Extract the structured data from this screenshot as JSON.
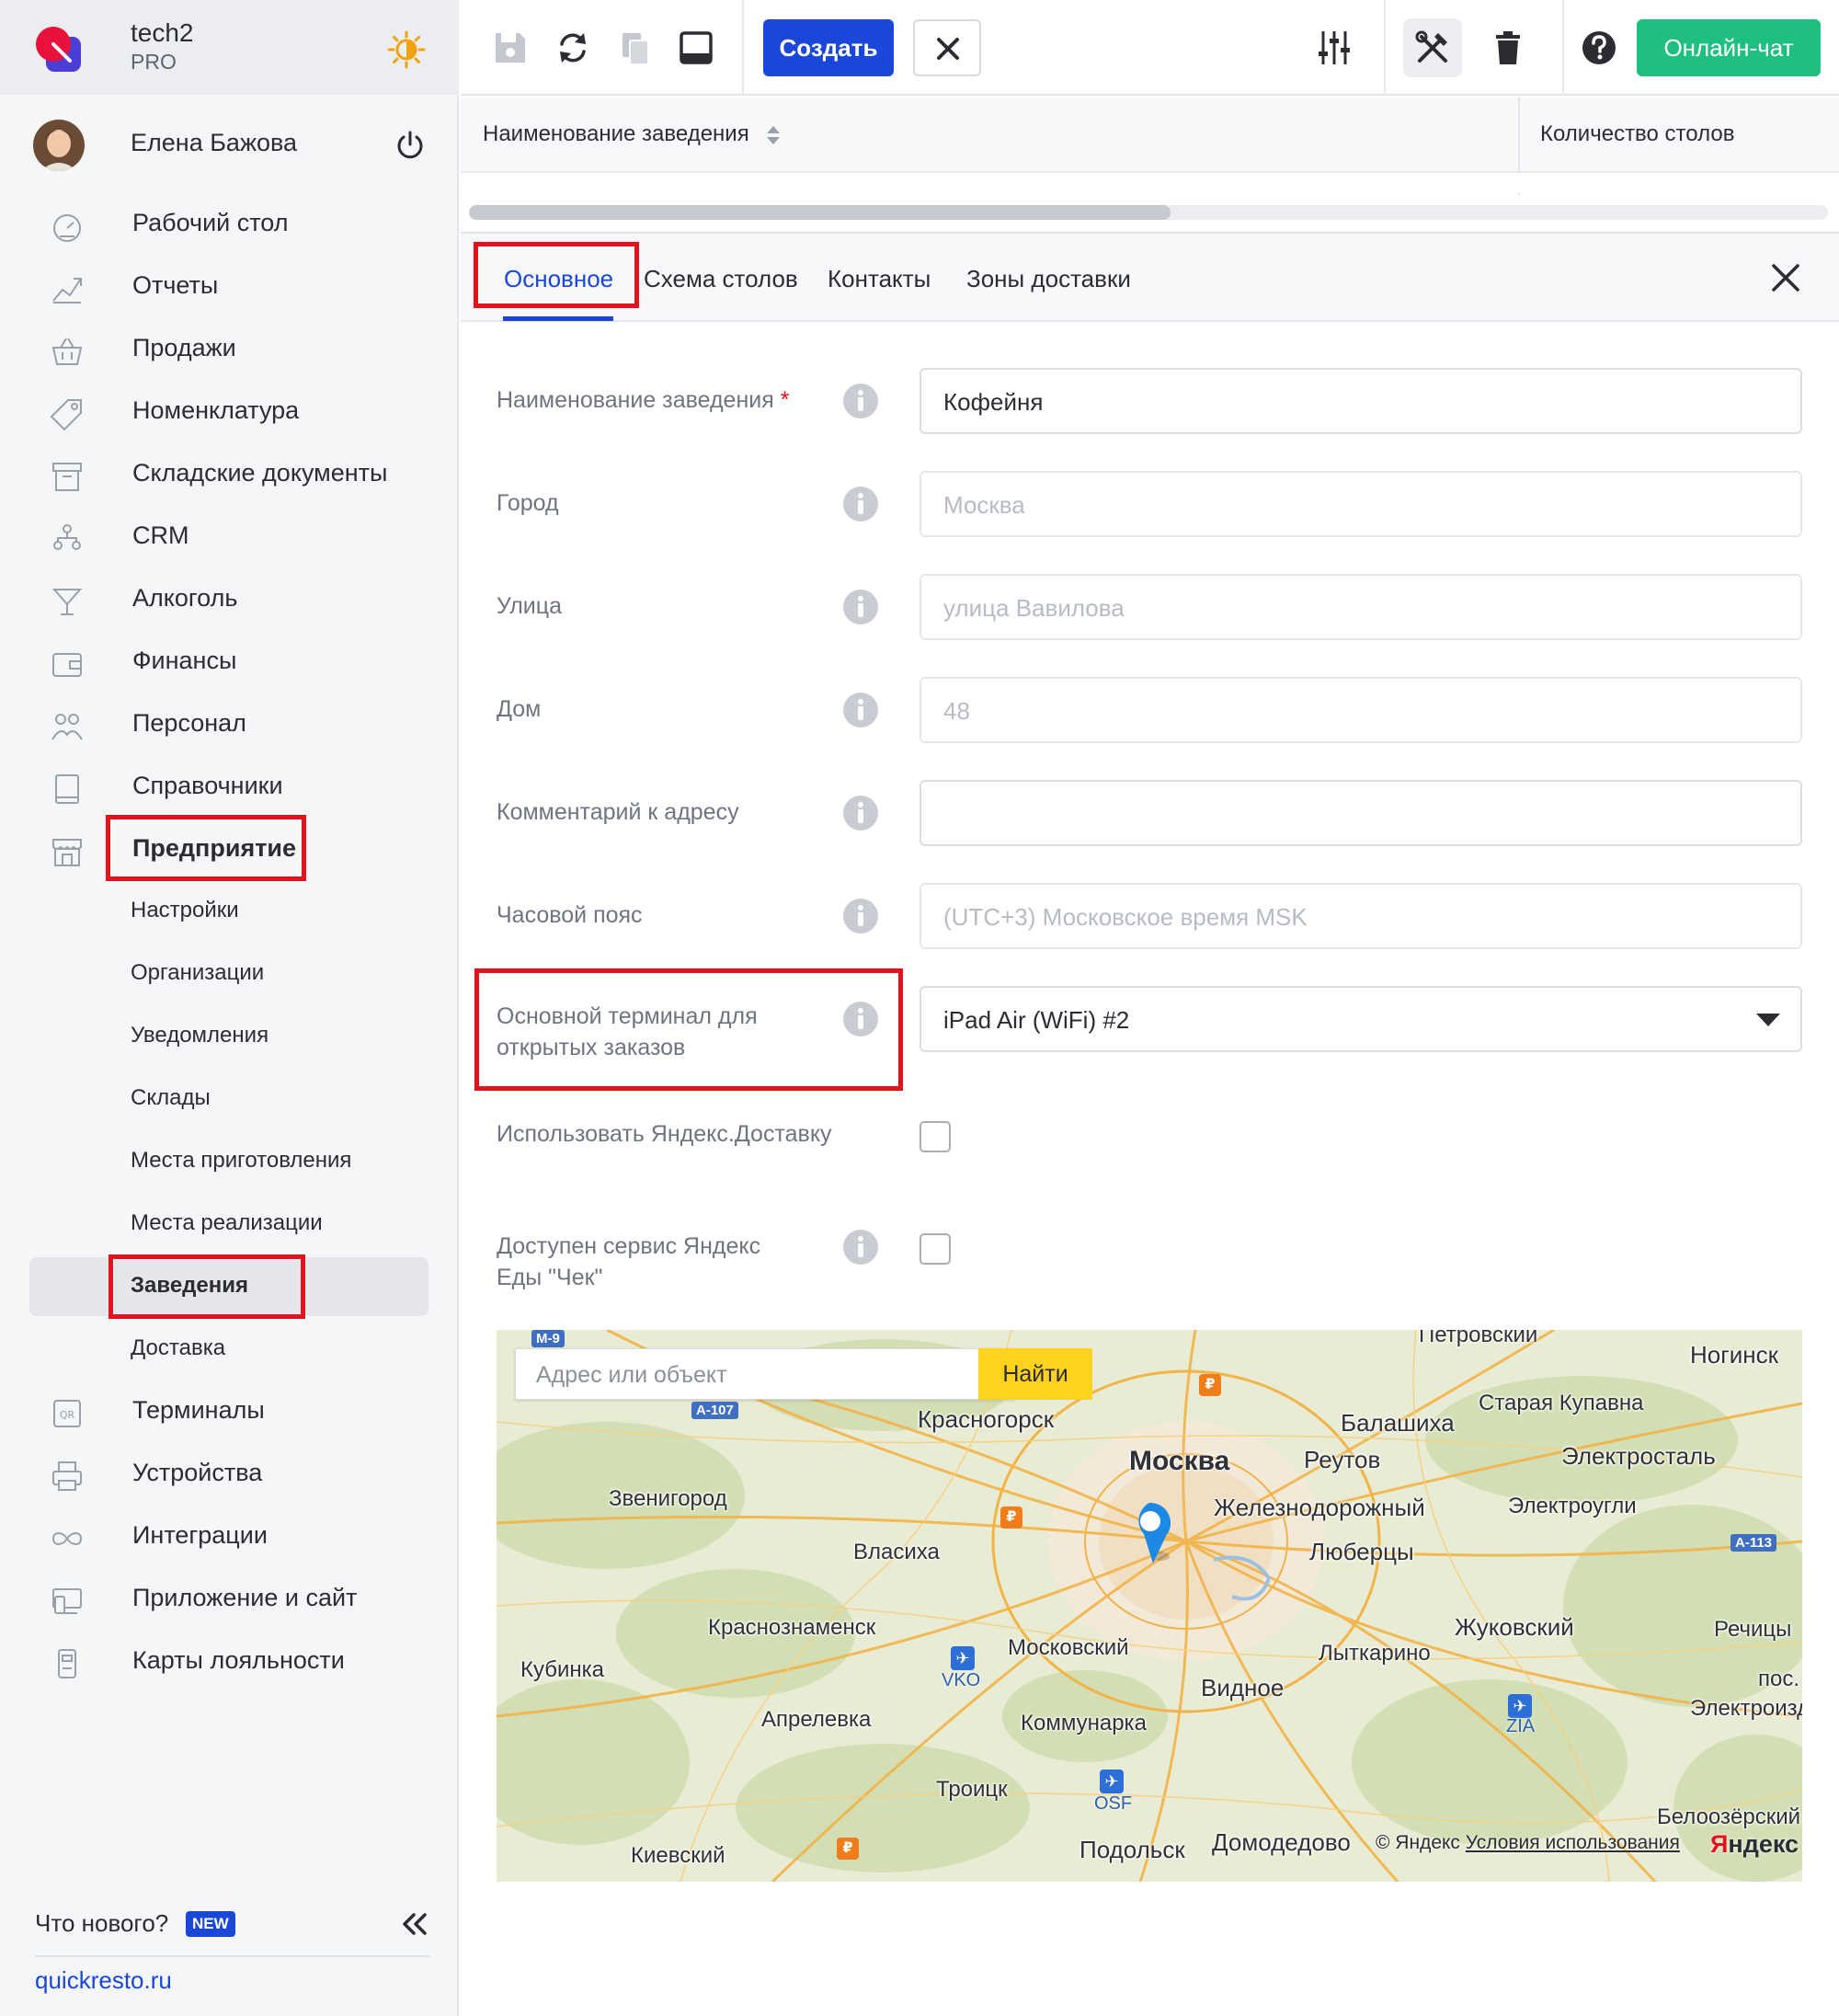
{
  "brand": {
    "name": "tech2",
    "plan": "PRO"
  },
  "user": {
    "name": "Елена Бажова"
  },
  "sidebar": {
    "items": [
      {
        "label": "Рабочий стол",
        "icon": "dashboard-icon"
      },
      {
        "label": "Отчеты",
        "icon": "chart-icon"
      },
      {
        "label": "Продажи",
        "icon": "basket-icon"
      },
      {
        "label": "Номенклатура",
        "icon": "tag-icon"
      },
      {
        "label": "Складские документы",
        "icon": "archive-icon"
      },
      {
        "label": "CRM",
        "icon": "people-tree-icon"
      },
      {
        "label": "Алкоголь",
        "icon": "cocktail-icon"
      },
      {
        "label": "Финансы",
        "icon": "wallet-icon"
      },
      {
        "label": "Персонал",
        "icon": "staff-icon"
      },
      {
        "label": "Справочники",
        "icon": "book-icon"
      },
      {
        "label": "Предприятие",
        "icon": "store-icon"
      }
    ],
    "subitems": [
      "Настройки",
      "Организации",
      "Уведомления",
      "Склады",
      "Места приготовления",
      "Места реализации",
      "Заведения",
      "Доставка"
    ],
    "items_after": [
      {
        "label": "Терминалы",
        "icon": "qr-icon"
      },
      {
        "label": "Устройства",
        "icon": "printer-icon"
      },
      {
        "label": "Интеграции",
        "icon": "infinity-icon"
      },
      {
        "label": "Приложение и сайт",
        "icon": "app-icon"
      },
      {
        "label": "Карты лояльности",
        "icon": "loyalty-card-icon"
      }
    ],
    "whats_new": "Что нового?",
    "new_badge": "NEW",
    "site": "quickresto.ru"
  },
  "toolbar": {
    "create": "Создать",
    "chat": "Онлайн-чат"
  },
  "grid": {
    "col1": "Наименование заведения",
    "col2": "Количество столов"
  },
  "tabs": [
    "Основное",
    "Схема столов",
    "Контакты",
    "Зоны доставки"
  ],
  "form": {
    "name_label": "Наименование заведения",
    "required_mark": "*",
    "name_value": "Кофейня",
    "city_label": "Город",
    "city_placeholder": "Москва",
    "street_label": "Улица",
    "street_placeholder": "улица Вавилова",
    "house_label": "Дом",
    "house_placeholder": "48",
    "comment_label": "Комментарий к адресу",
    "comment_value": "",
    "tz_label": "Часовой пояс",
    "tz_placeholder": "(UTC+3) Московское время MSK",
    "terminal_label_1": "Основной терминал для",
    "terminal_label_2": "открытых заказов",
    "terminal_value": "iPad Air (WiFi) #2",
    "yandex_delivery_label": "Использовать Яндекс.Доставку",
    "yandex_eda_label_1": "Доступен сервис Яндекс",
    "yandex_eda_label_2": "Еды \"Чек\""
  },
  "map": {
    "search_placeholder": "Адрес или объект",
    "find": "Найти",
    "copyright": "© Яндекс",
    "terms": "Условия использования",
    "logo_first": "Я",
    "logo_rest": "ндекс",
    "cities": {
      "moscow": "Москва",
      "krasnogorsk": "Красногорск",
      "balashikha": "Балашиха",
      "reutov": "Реутов",
      "zheleznodorozhny": "Железнодорожный",
      "lyubertsy": "Люберцы",
      "zvenigorod": "Звенигород",
      "vlasikha": "Власиха",
      "krasnoznamensk": "Краснознаменск",
      "moskovsky": "Московский",
      "kommunarka": "Коммунарка",
      "vidnoe": "Видное",
      "lytkarino": "Лыткарино",
      "zhukovsky": "Жуковский",
      "aprelevka": "Апрелевка",
      "kubinka": "Кубинка",
      "troitsk": "Троицк",
      "podolsk": "Подольск",
      "domodedovo": "Домодедово",
      "kievsky": "Киевский",
      "noginsk": "Ногинск",
      "staraya_kupavna": "Старая Купавна",
      "elektrostal": "Электросталь",
      "elektrougli": "Электроугли",
      "rechitsy": "Речицы",
      "pos": "пос.",
      "elektroizd": "Электроизд",
      "beloozersky": "Белоозёрский",
      "petrovsky": "Петровский"
    },
    "roads": {
      "m9": "М-9",
      "a107": "А-107",
      "a113": "А-113"
    },
    "airports": {
      "vko": "VKO",
      "osf": "OSF",
      "zia": "ZIA"
    }
  },
  "colors": {
    "accent": "#1a47d8",
    "chat": "#1fbf80",
    "highlight": "#e3121c",
    "find": "#ffd21f"
  }
}
